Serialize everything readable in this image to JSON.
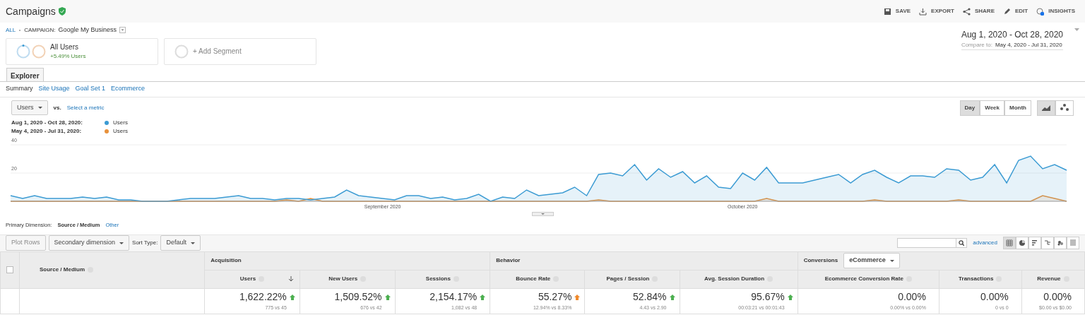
{
  "header": {
    "title": "Campaigns",
    "actions": [
      {
        "kind": "save",
        "label": "SAVE"
      },
      {
        "kind": "export",
        "label": "EXPORT"
      },
      {
        "kind": "share",
        "label": "SHARE"
      },
      {
        "kind": "edit",
        "label": "EDIT"
      },
      {
        "kind": "insights",
        "label": "INSIGHTS"
      }
    ]
  },
  "breadcrumb": {
    "root": "ALL",
    "label": "CAMPAIGN:",
    "value": "Google My Business"
  },
  "segments": [
    {
      "kind": "segment",
      "name": "All Users",
      "detail": "+5.49% Users"
    },
    {
      "kind": "add",
      "name": "+ Add Segment"
    }
  ],
  "date_range": {
    "main": "Aug 1, 2020 - Oct 28, 2020",
    "compare_label": "Compare to:",
    "compare": "May 4, 2020 - Jul 31, 2020"
  },
  "tabs": [
    {
      "label": "Explorer",
      "selected": true
    }
  ],
  "subtabs": [
    {
      "label": "Summary",
      "selected": true
    },
    {
      "label": "Site Usage",
      "selected": false
    },
    {
      "label": "Goal Set 1",
      "selected": false
    },
    {
      "label": "Ecommerce",
      "selected": false
    }
  ],
  "metric": {
    "value": "Users",
    "vs": "vs.",
    "select": "Select a metric"
  },
  "legend": [
    {
      "range": "Aug 1, 2020 - Oct 28, 2020:"
    },
    {
      "range": "May 4, 2020 - Jul 31, 2020:"
    }
  ],
  "granularity": [
    {
      "label": "Day",
      "selected": true
    },
    {
      "label": "Week",
      "selected": false
    },
    {
      "label": "Month",
      "selected": false
    }
  ],
  "chart_views": [
    {
      "kind": "line",
      "selected": true
    },
    {
      "kind": "motion",
      "selected": false
    }
  ],
  "chart": {
    "chart_data": {
      "type": "area",
      "ylim": [
        0,
        40
      ],
      "yticks": [
        20,
        40
      ],
      "categories": [
        null,
        null,
        null,
        null,
        null,
        null,
        null,
        null,
        null,
        null,
        null,
        null,
        null,
        null,
        null,
        null,
        null,
        null,
        null,
        null,
        null,
        null,
        null,
        null,
        null,
        null,
        null,
        null,
        null,
        null,
        null,
        "September 2020",
        null,
        null,
        null,
        null,
        null,
        null,
        null,
        null,
        null,
        null,
        null,
        null,
        null,
        null,
        null,
        null,
        null,
        null,
        null,
        null,
        null,
        null,
        null,
        null,
        null,
        null,
        null,
        null,
        null,
        "October 2020",
        null,
        null,
        null,
        null,
        null,
        null,
        null,
        null,
        null,
        null,
        null,
        null,
        null,
        null,
        null,
        null,
        null,
        null,
        null,
        null,
        null,
        null,
        null,
        null,
        null,
        null,
        null
      ],
      "series": [
        {
          "name": "Users",
          "color": "#3b9bd3",
          "values": [
            4,
            2,
            4,
            2,
            2,
            2,
            3,
            2,
            3,
            1,
            1,
            0,
            0,
            0,
            1,
            2,
            2,
            2,
            3,
            4,
            2,
            2,
            1,
            2,
            2,
            1,
            2,
            3,
            8,
            4,
            3,
            2,
            1,
            4,
            4,
            2,
            3,
            1,
            2,
            5,
            0,
            3,
            2,
            8,
            4,
            5,
            6,
            10,
            4,
            19,
            20,
            18,
            26,
            15,
            23,
            17,
            21,
            13,
            18,
            10,
            9,
            20,
            15,
            24,
            13,
            13,
            13,
            15,
            17,
            19,
            13,
            19,
            22,
            17,
            13,
            18,
            18,
            17,
            23,
            22,
            15,
            17,
            26,
            13,
            29,
            32,
            23,
            26,
            22
          ]
        },
        {
          "name": "Users",
          "color": "#e8913b",
          "values": [
            0,
            0,
            0,
            0,
            0,
            0,
            0,
            0,
            0,
            0,
            0,
            0,
            0,
            0,
            0,
            0,
            0,
            0,
            0,
            0,
            0,
            0,
            0,
            1,
            0,
            2,
            0,
            0,
            0,
            0,
            0,
            0,
            0,
            0,
            0,
            0,
            0,
            0,
            0,
            0,
            0,
            0,
            0,
            0,
            0,
            0,
            0,
            0,
            0,
            1,
            0,
            0,
            0,
            0,
            0,
            0,
            0,
            0,
            0,
            0,
            0,
            0,
            0,
            2,
            0,
            0,
            0,
            0,
            0,
            0,
            0,
            0,
            1,
            0,
            0,
            0,
            0,
            0,
            0,
            1,
            0,
            0,
            0,
            0,
            0,
            0,
            4,
            2,
            0
          ]
        }
      ]
    }
  },
  "dimension": {
    "label": "Primary Dimension:",
    "value": "Source / Medium",
    "other": "Other"
  },
  "toolbar": {
    "plot_rows": "Plot Rows",
    "secondary": "Secondary dimension",
    "sort_label": "Sort Type:",
    "sort": "Default",
    "advanced": "advanced"
  },
  "views": [
    {
      "kind": "table",
      "selected": true
    },
    {
      "kind": "pie",
      "selected": false
    },
    {
      "kind": "bars",
      "selected": false
    },
    {
      "kind": "compare",
      "selected": false
    },
    {
      "kind": "terms",
      "selected": false
    },
    {
      "kind": "pivot",
      "selected": false
    }
  ],
  "table": {
    "select_all": {
      "checked": false
    },
    "dimension": "Source / Medium",
    "groups": [
      {
        "name": "Acquisition",
        "columns": [
          {
            "name": "Users",
            "sorted": true
          },
          {
            "name": "New Users",
            "sorted": false
          },
          {
            "name": "Sessions",
            "sorted": false
          }
        ]
      },
      {
        "name": "Behavior",
        "columns": [
          {
            "name": "Bounce Rate",
            "sorted": false
          },
          {
            "name": "Pages / Session",
            "sorted": false
          },
          {
            "name": "Avg. Session Duration",
            "sorted": false
          }
        ]
      },
      {
        "name": "Conversions",
        "select": "eCommerce",
        "columns": [
          {
            "name": "Ecommerce Conversion Rate",
            "sorted": false
          },
          {
            "name": "Transactions",
            "sorted": false
          },
          {
            "name": "Revenue",
            "sorted": false
          }
        ]
      }
    ],
    "totals": [
      {
        "value": "1,622.22%",
        "color": "#4caf50",
        "detail": "775 vs 45"
      },
      {
        "value": "1,509.52%",
        "color": "#4caf50",
        "detail": "676 vs 42"
      },
      {
        "value": "2,154.17%",
        "color": "#4caf50",
        "detail": "1,082 vs 48"
      },
      {
        "value": "55.27%",
        "color": "#f08a2c",
        "detail": "12.94% vs 8.33%"
      },
      {
        "value": "52.84%",
        "color": "#4caf50",
        "detail": "4.43 vs 2.90"
      },
      {
        "value": "95.67%",
        "color": "#4caf50",
        "detail": "00:03:21 vs 00:01:43"
      },
      {
        "value": "0.00%",
        "detail": "0.00% vs 0.00%"
      },
      {
        "value": "0.00%",
        "detail": "0 vs 0"
      },
      {
        "value": "0.00%",
        "detail": "$0.00 vs $0.00"
      }
    ]
  }
}
